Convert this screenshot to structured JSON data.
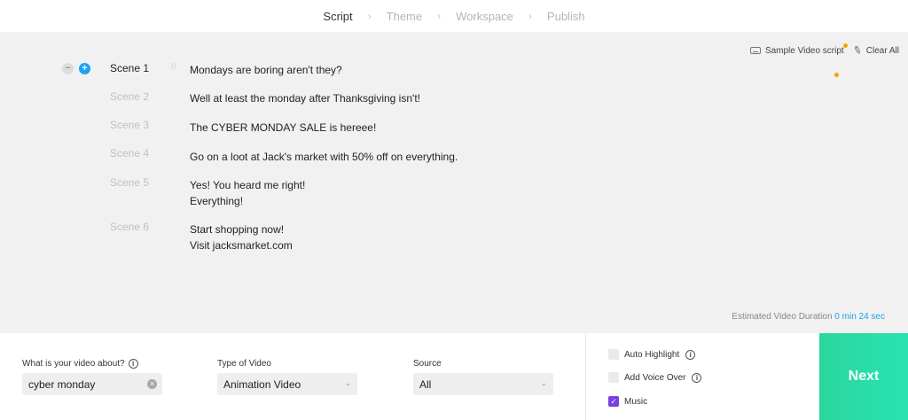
{
  "nav": {
    "steps": [
      {
        "label": "Script",
        "active": true
      },
      {
        "label": "Theme",
        "active": false
      },
      {
        "label": "Workspace",
        "active": false
      },
      {
        "label": "Publish",
        "active": false
      }
    ],
    "separator": "›"
  },
  "tools": {
    "sample_label": "Sample Video script",
    "clear_label": "Clear All",
    "icons": [
      "keyboard-icon",
      "brush-icon"
    ],
    "notification_color": "#f0a500"
  },
  "scene_controls": {
    "minus": "−",
    "plus": "+"
  },
  "scenes": [
    {
      "label": "Scene 1",
      "active": true,
      "lines": [
        "Mondays are boring aren't they?"
      ]
    },
    {
      "label": "Scene 2",
      "active": false,
      "lines": [
        "Well at least the monday after Thanksgiving isn't!"
      ]
    },
    {
      "label": "Scene 3",
      "active": false,
      "lines": [
        "The CYBER MONDAY SALE is hereee!"
      ]
    },
    {
      "label": "Scene 4",
      "active": false,
      "lines": [
        "Go on a loot at Jack's market with 50% off on everything."
      ]
    },
    {
      "label": "Scene 5",
      "active": false,
      "lines": [
        "Yes! You heard me right!",
        "Everything!"
      ]
    },
    {
      "label": "Scene 6",
      "active": false,
      "lines": [
        "Start shopping now!",
        "Visit jacksmarket.com"
      ]
    }
  ],
  "duration": {
    "label": "Estimated Video Duration",
    "value": "0 min 24 sec"
  },
  "form": {
    "about_label": "What is your video about?",
    "about_value": "cyber monday",
    "type_label": "Type of Video",
    "type_value": "Animation Video",
    "source_label": "Source",
    "source_value": "All"
  },
  "options": [
    {
      "label": "Auto Highlight",
      "checked": false,
      "info": true
    },
    {
      "label": "Add Voice Over",
      "checked": false,
      "info": true
    },
    {
      "label": "Music",
      "checked": true,
      "info": false
    }
  ],
  "next_label": "Next",
  "colors": {
    "accent": "#1da1f2",
    "next_bg": "#2ad79e",
    "checkbox_on": "#7b3fe4"
  }
}
